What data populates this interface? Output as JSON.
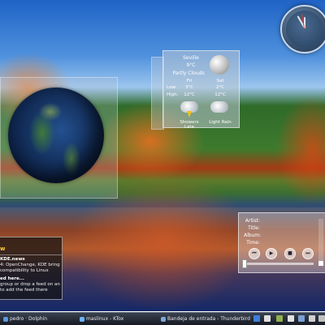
{
  "weather": {
    "city": "Seville",
    "temp": "9°C",
    "condition": "Partly Clouds",
    "row_labels": {
      "low": "Low:",
      "high": "High:"
    },
    "days": [
      {
        "name": "Fri",
        "low": "3°C",
        "high": "12°C",
        "condition": "Showers Late",
        "icon": "thunderstorm-icon"
      },
      {
        "name": "Sat",
        "low": "2°C",
        "high": "12°C",
        "condition": "Light Rain",
        "icon": "rain-cloud-icon"
      }
    ]
  },
  "feed": {
    "title": "w",
    "item1_title": "KDE.news",
    "item1_text": "4: OpenChange, KDE bring compatibility to Linux",
    "item2_title": "ed here...",
    "item2_text": "group or drop a feed on an to add the feed there"
  },
  "player": {
    "labels": {
      "artist": "Artist:",
      "title": "Title:",
      "album": "Album:",
      "time": "Time:"
    },
    "icons": [
      "previous-icon",
      "play-icon",
      "stop-icon",
      "next-icon"
    ],
    "progress": 0.0,
    "volume": 0.1
  },
  "taskbar": {
    "tasks": [
      {
        "label": "pedro · Dolphin",
        "icon": "folder-icon",
        "color": "#5a9ae0"
      },
      {
        "label": "maslinux - KTox",
        "icon": "chat-icon",
        "color": "#6fb2ff"
      },
      {
        "label": "Bandeja de entrada - Thunderbird",
        "icon": "mail-icon",
        "color": "#7fa7d8"
      }
    ],
    "tray_colors": [
      "#3d7fd9",
      "#e0e0e0",
      "#90b050",
      "#e2e2e2",
      "#7aa0d8",
      "#d0d0d0",
      "#c0c0c0"
    ]
  }
}
